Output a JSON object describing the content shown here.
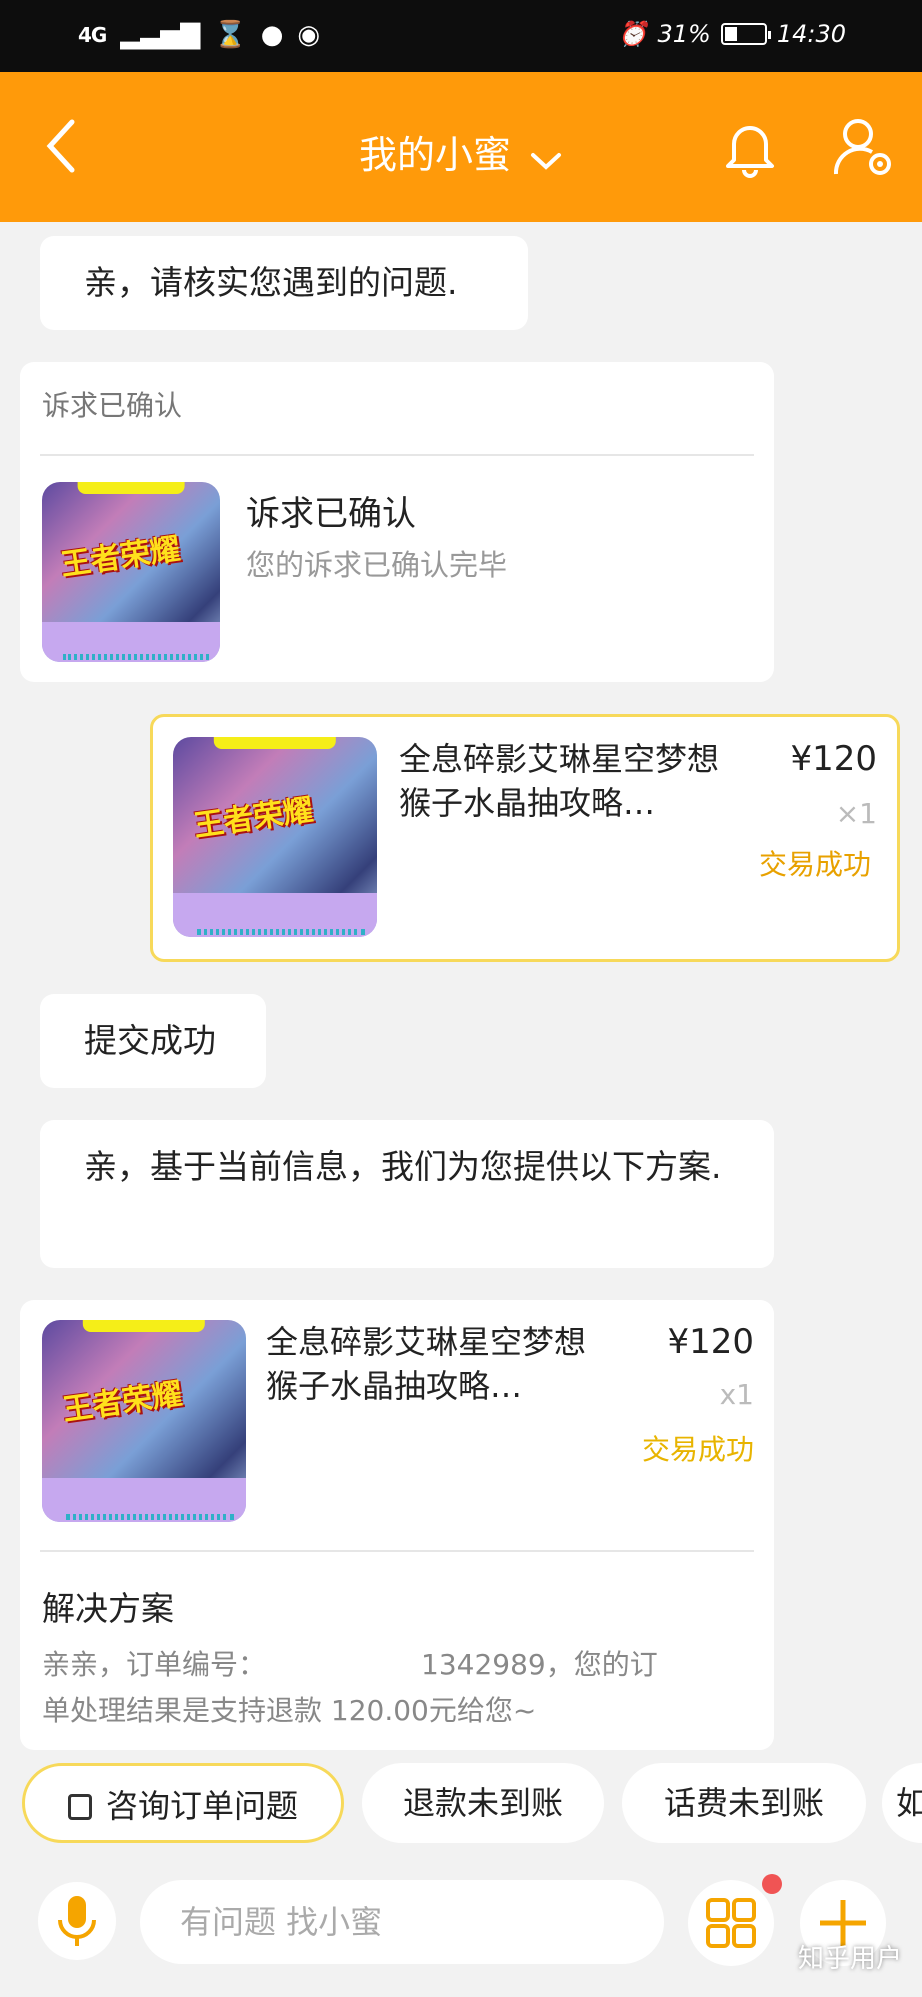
{
  "status_bar": {
    "network": "4G",
    "battery_text": "31%",
    "battery_level": 0.31,
    "time": "14:30"
  },
  "header": {
    "title": "我的小蜜"
  },
  "messages": {
    "m1": "亲，请核实您遇到的问题.",
    "appeal_card": {
      "caption": "诉求已确认",
      "title": "诉求已确认",
      "subtitle": "您的诉求已确认完毕"
    },
    "order_card": {
      "title": "全息碎影艾琳星空梦想猴子水晶抽攻略…",
      "price": "¥120",
      "qty": "×1",
      "status": "交易成功"
    },
    "m2": "提交成功",
    "m3": "亲，基于当前信息，我们为您提供以下方案.",
    "solution_card": {
      "title": "全息碎影艾琳星空梦想猴子水晶抽攻略…",
      "price": "¥120",
      "qty": "x1",
      "status": "交易成功",
      "heading": "解决方案",
      "body_prefix": "亲亲，订单编号：",
      "body_visible_tail": "1342989，您的订",
      "body_line2": "单处理结果是支持退款 120.00元给您~"
    },
    "thumb_logo": "王者荣耀"
  },
  "chips": [
    "咨询订单问题",
    "退款未到账",
    "话费未到账",
    "如"
  ],
  "input": {
    "placeholder": "有问题 找小蜜"
  },
  "watermark": "知乎用户",
  "colors": {
    "brand": "#ff9a0a",
    "success": "#e8a100",
    "border_accent": "#f7d95a"
  }
}
